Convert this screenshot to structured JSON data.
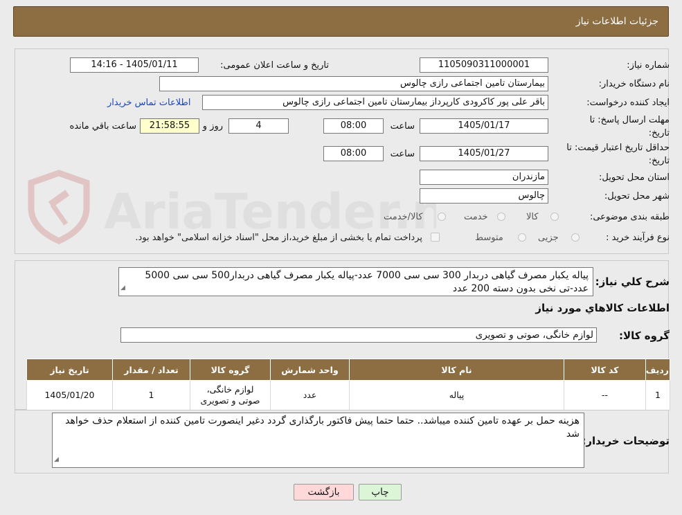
{
  "header": {
    "title": "جزئیات اطلاعات نیاز"
  },
  "form": {
    "need_number_label": "شماره نیاز:",
    "need_number": "1105090311000001",
    "announce_label": "تاریخ و ساعت اعلان عمومی:",
    "announce_value": "1405/01/11 - 14:16",
    "buyer_org_label": "نام دستگاه خریدار:",
    "buyer_org": "بیمارستان تامین اجتماعی رازی چالوس",
    "creator_label": "ایجاد کننده درخواست:",
    "creator": "باقر علی پور کاکرودی کارپرداز بیمارستان تامین اجتماعی رازی چالوس",
    "buyer_contact_link": "اطلاعات تماس خریدار",
    "deadline_label_1": "مهلت ارسال پاسخ: تا",
    "deadline_label_2": "تاریخ:",
    "deadline_date": "1405/01/17",
    "time_label": "ساعت",
    "deadline_time": "08:00",
    "days_value": "4",
    "days_label": "روز و",
    "remaining_time": "21:58:55",
    "remaining_label": "ساعت باقي مانده",
    "validity_label_1": "حداقل تاریخ اعتبار قیمت: تا",
    "validity_label_2": "تاریخ:",
    "validity_date": "1405/01/27",
    "validity_time": "08:00",
    "province_label": "استان محل تحویل:",
    "province": "مازندران",
    "city_label": "شهر محل تحویل:",
    "city": "چالوس",
    "category_label": "طبقه بندی موضوعی:",
    "category_options": [
      "کالا",
      "خدمت",
      "کالا/خدمت"
    ],
    "process_label": "نوع فرآیند خرید :",
    "process_options": [
      "جزیی",
      "متوسط"
    ],
    "payment_note": "پرداخت تمام یا بخشی از مبلغ خرید،از محل \"اسناد خزانه اسلامی\" خواهد بود."
  },
  "summary": {
    "label": "شرح کلي نیاز:",
    "text": "پیاله یکبار مصرف گیاهی دربدار 300 سی سی 7000 عدد-پیاله یکبار مصرف گیاهی دربدار500 سی سی 5000 عدد-تی نخی بدون دسته 200 عدد"
  },
  "goods": {
    "section_title": "اطلاعات کالاهاي مورد نیاز",
    "group_label": "گروه کالا:",
    "group_value": "لوازم خانگی، صوتی و تصویری",
    "columns": [
      "ردیف",
      "کد کالا",
      "نام کالا",
      "واحد شمارش",
      "گروه کالا",
      "تعداد / مقدار",
      "تاریخ نیاز"
    ],
    "rows": [
      [
        "1",
        "--",
        "پیاله",
        "عدد",
        "لوازم خانگی، صوتی و تصویری",
        "1",
        "1405/01/20"
      ]
    ]
  },
  "buyer_notes": {
    "label": "توضیحات خریدار:",
    "text": "هزینه حمل بر عهده تامین کننده میباشد.. حتما حتما پیش فاکتور بارگذاری گردد دغیر اینصورت تامین کننده از استعلام  حذف خواهد شد"
  },
  "buttons": {
    "print": "چاپ",
    "back": "بازگشت"
  },
  "watermark": {
    "text": "AriaTender.neT"
  },
  "colors": {
    "header": "#8d6e43",
    "link": "#1a44c8",
    "back_button": "#ffd9d9",
    "print_button": "#dcf5d6"
  }
}
